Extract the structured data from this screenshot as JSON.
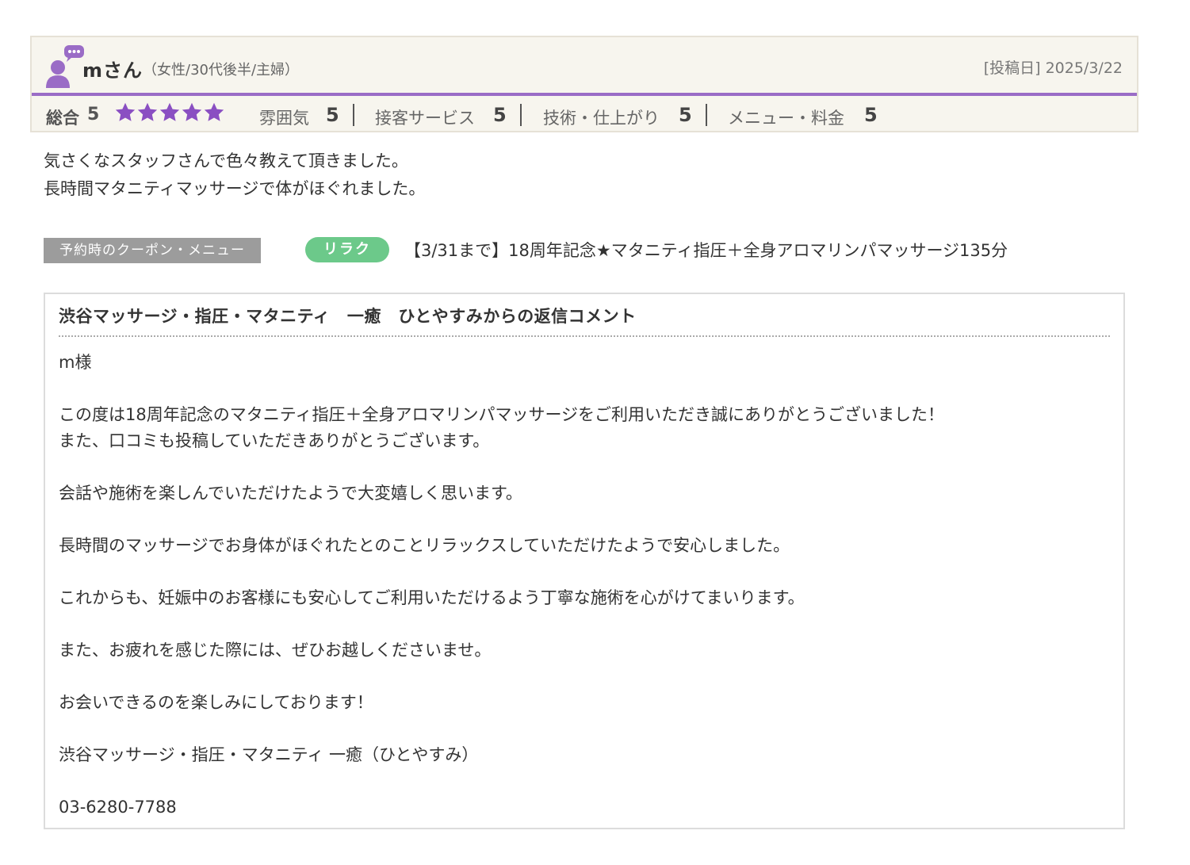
{
  "reviewer": {
    "name": "mさん",
    "attributes": "（女性/30代後半/主婦）",
    "post_date": "[投稿日] 2025/3/22",
    "avatar_icon": "user-comment-icon"
  },
  "ratings": {
    "overall_label": "総合",
    "overall_score": "5",
    "stars": 5,
    "star_color": "#8a4fc2",
    "items": [
      {
        "label": "雰囲気",
        "score": "5"
      },
      {
        "label": "接客サービス",
        "score": "5"
      },
      {
        "label": "技術・仕上がり",
        "score": "5"
      },
      {
        "label": "メニュー・料金",
        "score": "5"
      }
    ]
  },
  "review_body": {
    "lines": [
      "気さくなスタッフさんで色々教えて頂きました。",
      "長時間マタニティマッサージで体がほぐれました。"
    ]
  },
  "coupon": {
    "label": "予約時のクーポン・メニュー",
    "badge": "リラク",
    "name": "【3/31まで】18周年記念★マタニティ指圧＋全身アロマリンパマッサージ135分"
  },
  "reply": {
    "title": "渋谷マッサージ・指圧・マタニティ　一癒　ひとやすみからの返信コメント",
    "paragraphs": [
      "m様",
      "この度は18周年記念のマタニティ指圧＋全身アロマリンパマッサージをご利用いただき誠にありがとうございました！",
      "また、口コミも投稿していただきありがとうございます。",
      "会話や施術を楽しんでいただけたようで大変嬉しく思います。",
      "長時間のマッサージでお身体がほぐれたとのことリラックスしていただけたようで安心しました。",
      "これからも、妊娠中のお客様にも安心してご利用いただけるよう丁寧な施術を心がけてまいります。",
      "また、お疲れを感じた際には、ぜひお越しくださいませ。",
      "お会いできるのを楽しみにしております！",
      "渋谷マッサージ・指圧・マタニティ 一癒（ひとやすみ）",
      "03-6280-7788"
    ]
  },
  "colors": {
    "accent_purple": "#9a6cc6",
    "badge_green": "#6cc98a",
    "header_bg": "#f7f5ee"
  }
}
